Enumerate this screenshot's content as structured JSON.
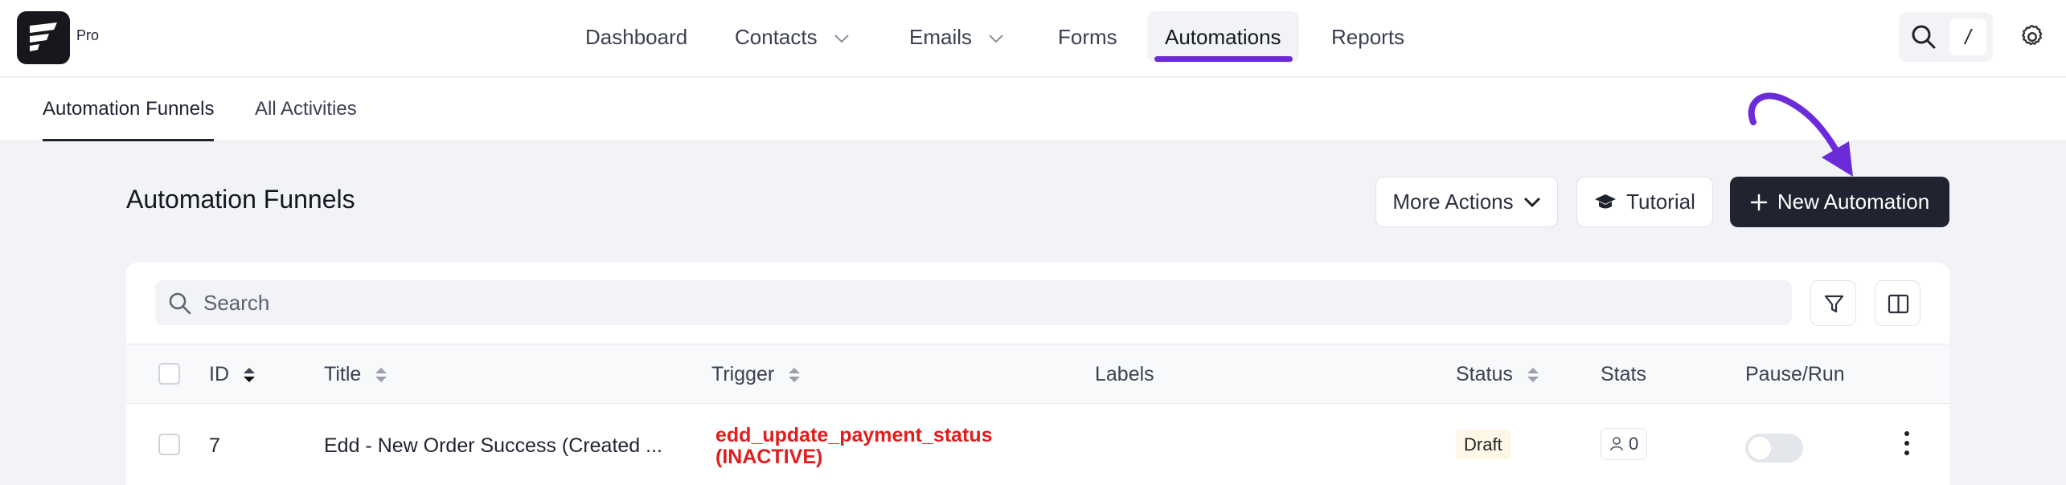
{
  "brand": {
    "plan": "Pro"
  },
  "nav": {
    "items": [
      {
        "label": "Dashboard"
      },
      {
        "label": "Contacts"
      },
      {
        "label": "Emails"
      },
      {
        "label": "Forms"
      },
      {
        "label": "Automations"
      },
      {
        "label": "Reports"
      }
    ],
    "active": "Automations",
    "shortcut_key": "/"
  },
  "subnav": {
    "tabs": [
      {
        "label": "Automation Funnels"
      },
      {
        "label": "All Activities"
      }
    ],
    "active": "Automation Funnels"
  },
  "page": {
    "title": "Automation Funnels",
    "buttons": {
      "more_actions": "More Actions",
      "tutorial": "Tutorial",
      "new_automation": "New Automation"
    }
  },
  "search": {
    "placeholder": "Search",
    "value": ""
  },
  "table": {
    "columns": {
      "id": "ID",
      "title": "Title",
      "trigger": "Trigger",
      "labels": "Labels",
      "status": "Status",
      "stats": "Stats",
      "pause_run": "Pause/Run"
    },
    "rows": [
      {
        "id": "7",
        "title": "Edd - New Order Success (Created ...",
        "trigger_name": "edd_update_payment_status",
        "trigger_state": "(INACTIVE)",
        "labels": "",
        "status": "Draft",
        "stats": "0",
        "running": false
      }
    ]
  },
  "colors": {
    "accent": "#6c2bd9",
    "primary_button": "#1f2430",
    "trigger_inactive": "#e11d1d",
    "draft_badge": "#fdf7e5"
  }
}
